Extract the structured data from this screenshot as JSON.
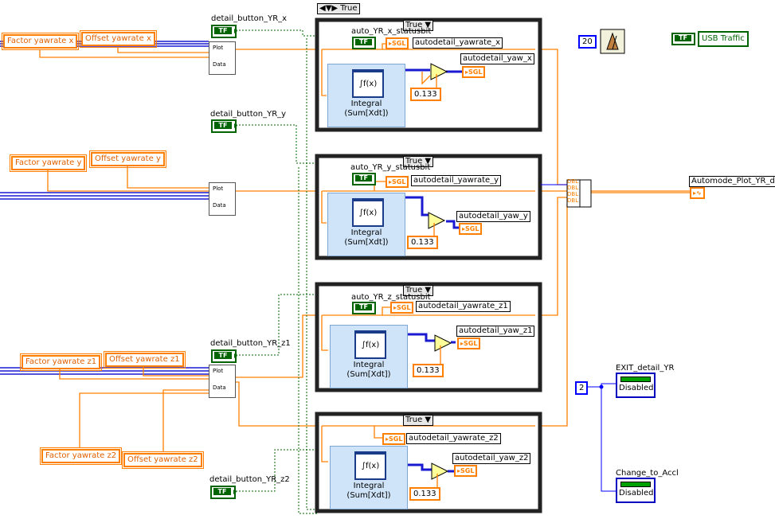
{
  "top_selector": "True",
  "frames": [
    {
      "selector": "True",
      "status_label": "auto_YR_x_statusbit",
      "yawrate_label": "autodetail_yawrate_x",
      "yaw_label": "autodetail_yaw_x",
      "constant": "0.133"
    },
    {
      "selector": "True",
      "status_label": "auto_YR_y_statusbit",
      "yawrate_label": "autodetail_yawrate_y",
      "yaw_label": "autodetail_yaw_y",
      "constant": "0.133"
    },
    {
      "selector": "True",
      "status_label": "auto_YR_z_statusbit",
      "yawrate_label": "autodetail_yawrate_z1",
      "yaw_label": "autodetail_yaw_z1",
      "constant": "0.133"
    },
    {
      "selector": "True",
      "status_label": "",
      "yawrate_label": "autodetail_yawrate_z2",
      "yaw_label": "autodetail_yaw_z2",
      "constant": "0.133"
    }
  ],
  "buttons": {
    "yr_x": "detail_button_YR_x",
    "yr_y": "detail_button_YR_y",
    "yr_z1": "detail_button_YR_z1",
    "yr_z2": "detail_button_YR_z2"
  },
  "constants": {
    "factor_x": "Factor yawrate x",
    "offset_x": "Offset yawrate x",
    "factor_y": "Factor yawrate y",
    "offset_y": "Offset yawrate y",
    "factor_z1": "Factor yawrate z1",
    "offset_z1": "Offset yawrate z1",
    "factor_z2": "Factor yawrate z2",
    "offset_z2": "Offset yawrate z2"
  },
  "node": {
    "integral_title": "Integral",
    "integral_sub": "(Sum[Xdt])",
    "integral_icon": "∫f(x)",
    "sgl": "SGL",
    "tf": "TF",
    "plot": "Plot",
    "data": "Data",
    "dbl": "DBL"
  },
  "right": {
    "wait_value": "20",
    "usb_label": "USB Traffic",
    "automode_label": "Automode_Plot_YR_de",
    "exit_label": "EXIT_detail_YR",
    "accl_label": "Change_to_Accl",
    "disabled_text": "Disabled",
    "const_2": "2"
  }
}
